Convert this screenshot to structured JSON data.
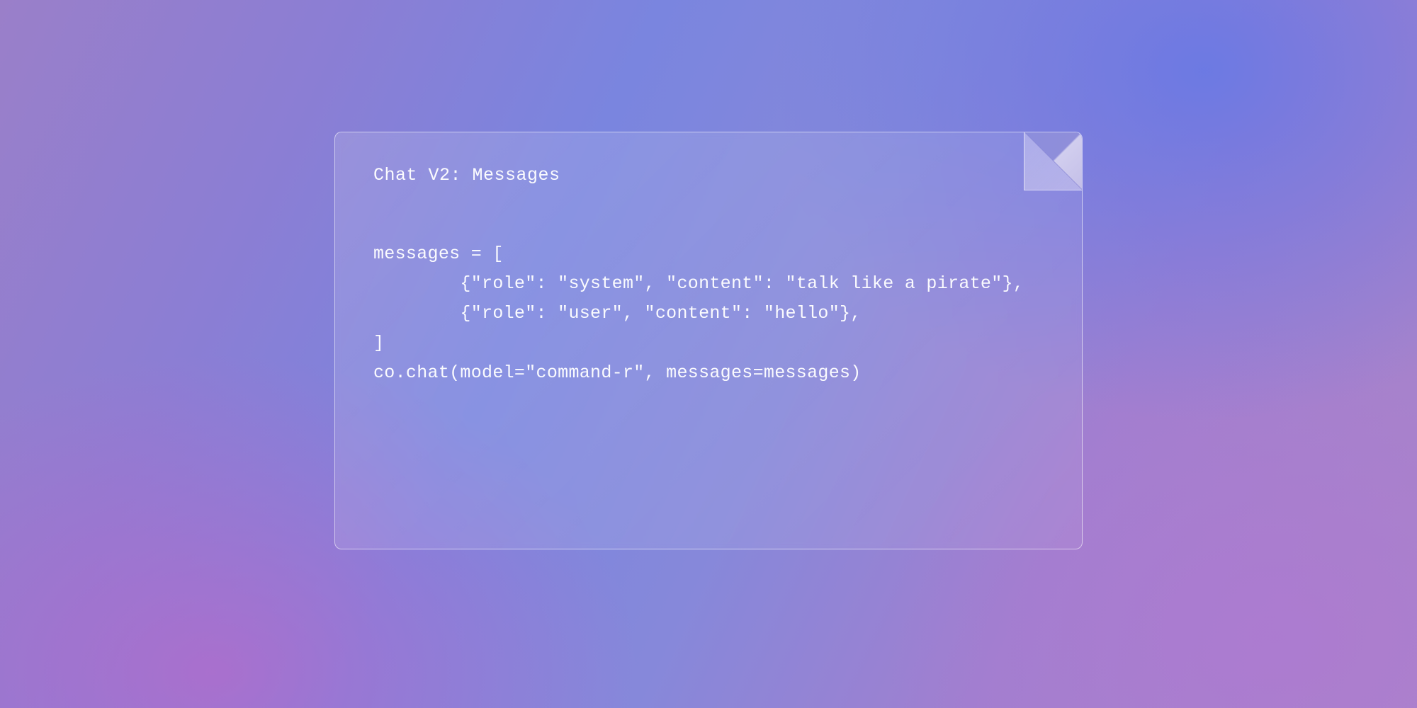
{
  "card": {
    "title": "Chat V2: Messages",
    "code_lines": [
      "messages = [",
      "        {\"role\": \"system\", \"content\": \"talk like a pirate\"},",
      "        {\"role\": \"user\", \"content\": \"hello\"},",
      "]",
      "co.chat(model=\"command-r\", messages=messages)"
    ]
  }
}
